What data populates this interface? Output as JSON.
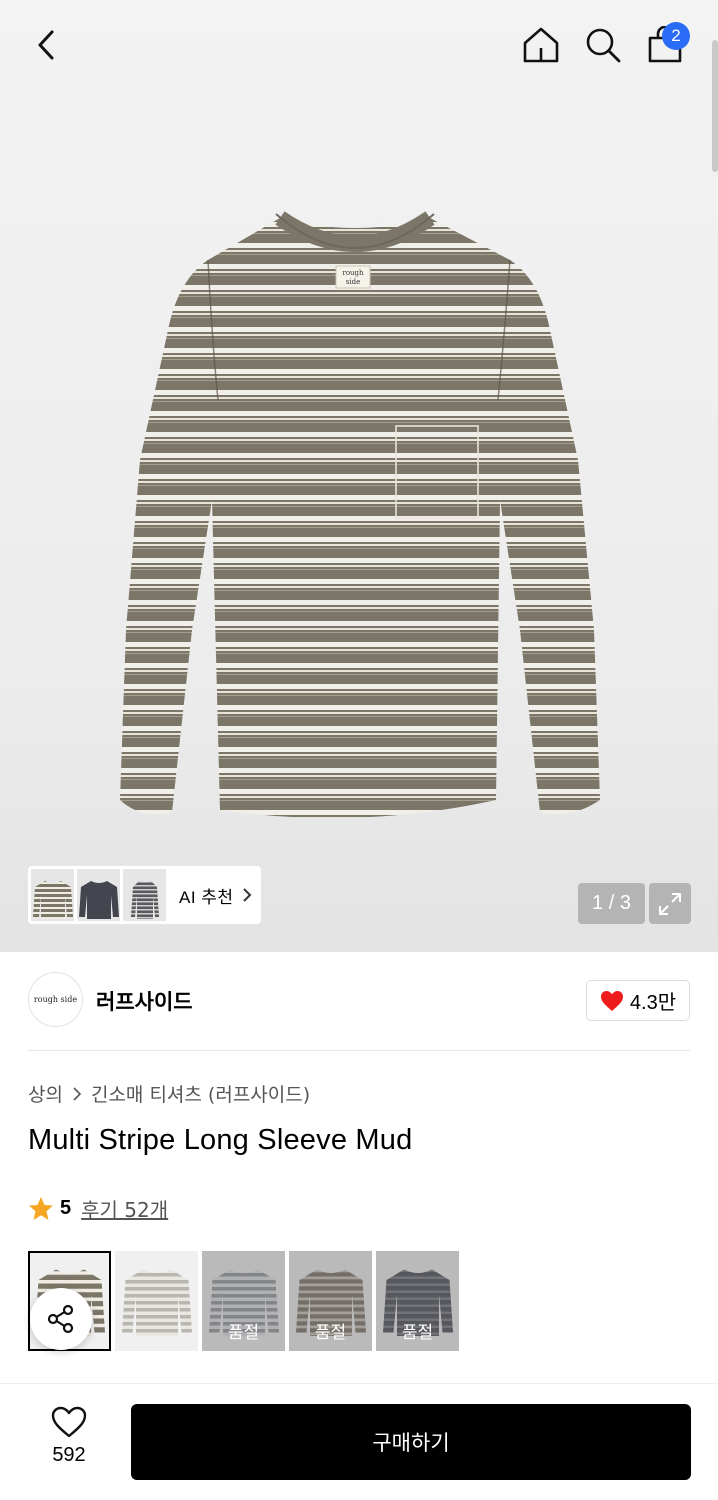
{
  "header": {
    "back_icon": "chevron-left-icon",
    "home_icon": "home-icon",
    "search_icon": "search-icon",
    "cart_icon": "shopping-bag-icon",
    "cart_count": "2",
    "badge_color": "#2a6cf5"
  },
  "gallery": {
    "counter": "1 / 3",
    "current": 1,
    "total": 3,
    "ai_label": "AI 추천",
    "expand_icon": "expand-icon",
    "product_colors": {
      "base": "#7b7668",
      "stripe_light": "#f1efe9",
      "label": "#f5f2ea"
    },
    "label_text": [
      "rough",
      "side"
    ]
  },
  "brand": {
    "logo_text": "rough side",
    "name": "러프사이드",
    "likes": "4.3만",
    "heart_color": "#ee1c1c"
  },
  "product": {
    "breadcrumb": [
      "상의",
      "긴소매 티셔츠 (러프사이드)"
    ],
    "title": "Multi Stripe Long Sleeve Mud",
    "rating": "5",
    "reviews": "후기 52개",
    "star_color": "#f5a623"
  },
  "swatches": [
    {
      "selected": true,
      "soldout": false,
      "color": "#7b7668"
    },
    {
      "selected": false,
      "soldout": false,
      "color": "#b8b6ae"
    },
    {
      "selected": false,
      "soldout": true,
      "label": "품절",
      "color": "#8c9196"
    },
    {
      "selected": false,
      "soldout": true,
      "label": "품절",
      "color": "#6f665a"
    },
    {
      "selected": false,
      "soldout": true,
      "label": "품절",
      "color": "#3c3f48"
    }
  ],
  "bottom": {
    "wish_count": "592",
    "buy_label": "구매하기"
  }
}
